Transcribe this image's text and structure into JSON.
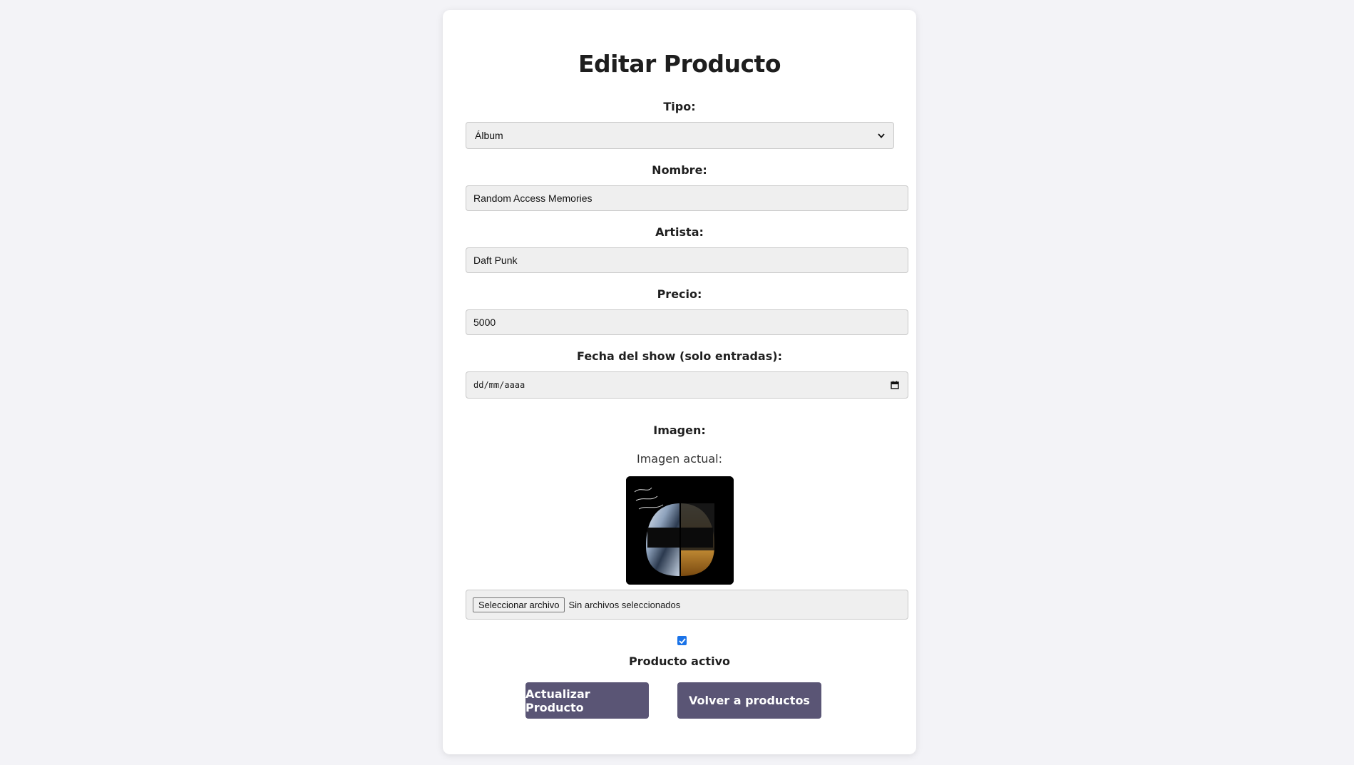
{
  "form": {
    "title": "Editar Producto",
    "tipo_label": "Tipo:",
    "tipo_value": "Álbum",
    "nombre_label": "Nombre:",
    "nombre_value": "Random Access Memories",
    "artista_label": "Artista:",
    "artista_value": "Daft Punk",
    "precio_label": "Precio:",
    "precio_value": "5000",
    "fecha_label": "Fecha del show (solo entradas):",
    "fecha_placeholder": "dd/mm/aaaa",
    "imagen_label": "Imagen:",
    "imagen_actual_label": "Imagen actual:",
    "file_button_label": "Seleccionar archivo",
    "file_status": "Sin archivos seleccionados",
    "activo_checked": true,
    "activo_label": "Producto activo",
    "submit_label": "Actualizar Producto",
    "back_label": "Volver a productos"
  },
  "icons": {
    "select": "chevron-down-icon",
    "date": "calendar-icon",
    "checkbox": "checkmark-icon"
  },
  "colors": {
    "page_background": "#f3f3f7",
    "card_background": "#ffffff",
    "button_background": "#5a5575",
    "checkbox_accent": "#1a73e8",
    "field_background": "#efefef"
  }
}
